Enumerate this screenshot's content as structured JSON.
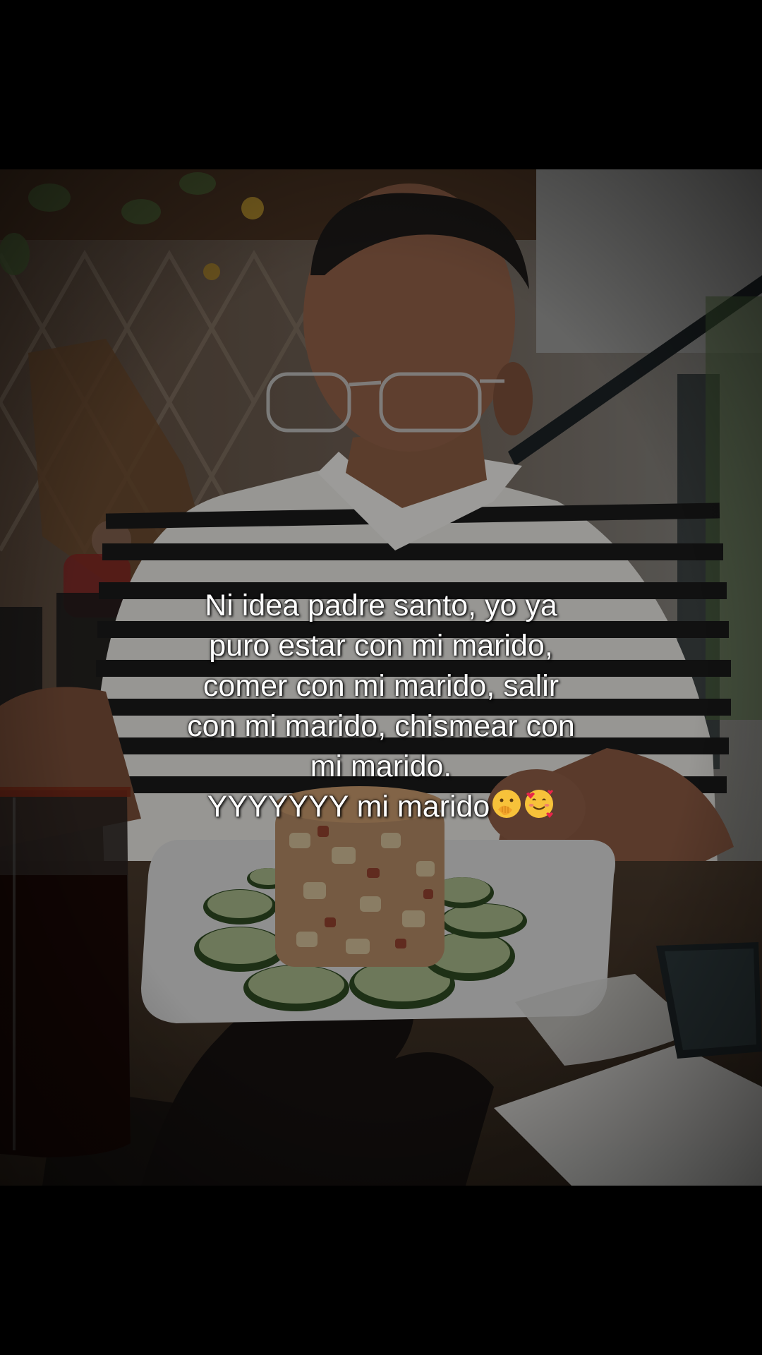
{
  "caption": {
    "lines": [
      "Ni idea padre santo, yo ya",
      "puro estar con mi marido,",
      "comer con mi marido, salir",
      "con mi marido, chismear con",
      "mi marido.",
      "YYYYYYY mi marido"
    ],
    "emojis": [
      "hand-over-mouth-emoji",
      "smiling-face-with-hearts-emoji"
    ]
  },
  "colors": {
    "background": "#000000",
    "caption_text": "#ffffff"
  }
}
